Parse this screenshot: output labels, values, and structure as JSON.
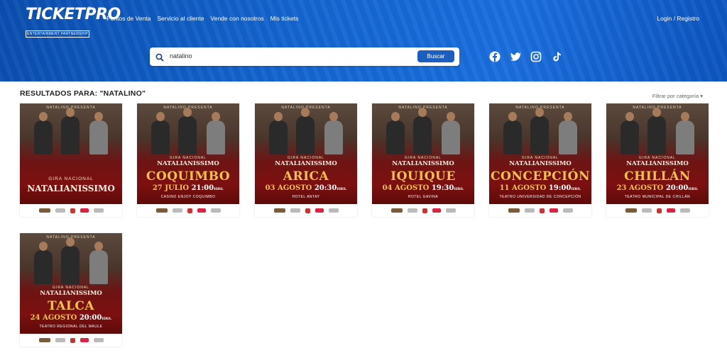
{
  "header": {
    "logo": {
      "name": "TICKETPRO",
      "reg": "®",
      "tagline": "ENTERTAINMENT PARTNERSHIP"
    },
    "nav": [
      "Puntos de Venta",
      "Servicio al cliente",
      "Vende con nosotros",
      "Mis tickets"
    ],
    "login": "Login / Registro",
    "search": {
      "value": "natalino",
      "button": "Buscar"
    },
    "social": [
      "facebook-icon",
      "twitter-icon",
      "instagram-icon",
      "tiktok-icon"
    ]
  },
  "results": {
    "title": "RESULTADOS PARA: \"NATALINO\"",
    "filter": "Filtrar por categoría ▾"
  },
  "events": [
    {
      "presenta": "NATALINO PRESENTA",
      "gira": "GIRA NACIONAL",
      "show": "NATALIANISSIMO",
      "city": "",
      "date": "",
      "time": "",
      "hrs": "",
      "venue": ""
    },
    {
      "presenta": "NATALINO PRESENTA",
      "gira": "GIRA NACIONAL",
      "show": "NATALIANISSIMO",
      "city": "COQUIMBO",
      "date": "27 JULIO",
      "time": "21:00",
      "hrs": "HRS.",
      "venue": "CASINO ENJOY COQUIMBO"
    },
    {
      "presenta": "NATALINO PRESENTA",
      "gira": "GIRA NACIONAL",
      "show": "NATALIANISSIMO",
      "city": "ARICA",
      "date": "03 AGOSTO",
      "time": "20:30",
      "hrs": "HRS.",
      "venue": "HOTEL ANTAY"
    },
    {
      "presenta": "NATALINO PRESENTA",
      "gira": "GIRA NACIONAL",
      "show": "NATALIANISSIMO",
      "city": "IQUIQUE",
      "date": "04 AGOSTO",
      "time": "19:30",
      "hrs": "HRS.",
      "venue": "HOTEL GAVINA"
    },
    {
      "presenta": "NATALINO PRESENTA",
      "gira": "GIRA NACIONAL",
      "show": "NATALIANISSIMO",
      "city": "CONCEPCIÓN",
      "date": "11 AGOSTO",
      "time": "19:00",
      "hrs": "HRS.",
      "venue": "TEATRO UNIVERSIDAD DE CONCEPCIÓN"
    },
    {
      "presenta": "NATALINO PRESENTA",
      "gira": "GIRA NACIONAL",
      "show": "NATALIANISSIMO",
      "city": "CHILLÁN",
      "date": "23 AGOSTO",
      "time": "20:00",
      "hrs": "HRS.",
      "venue": "TEATRO MUNICIPAL DE CHILLÁN"
    },
    {
      "presenta": "NATALINO PRESENTA",
      "gira": "GIRA NACIONAL",
      "show": "NATALIANISSIMO",
      "city": "TALCA",
      "date": "24 AGOSTO",
      "time": "20:00",
      "hrs": "HRS.",
      "venue": "TEATRO REGIONAL DEL MAULE"
    }
  ],
  "colors": {
    "header": "#1466d2",
    "poster_red": "#7d1010",
    "gold": "#f1c24d",
    "button": "#1a5fbf"
  }
}
